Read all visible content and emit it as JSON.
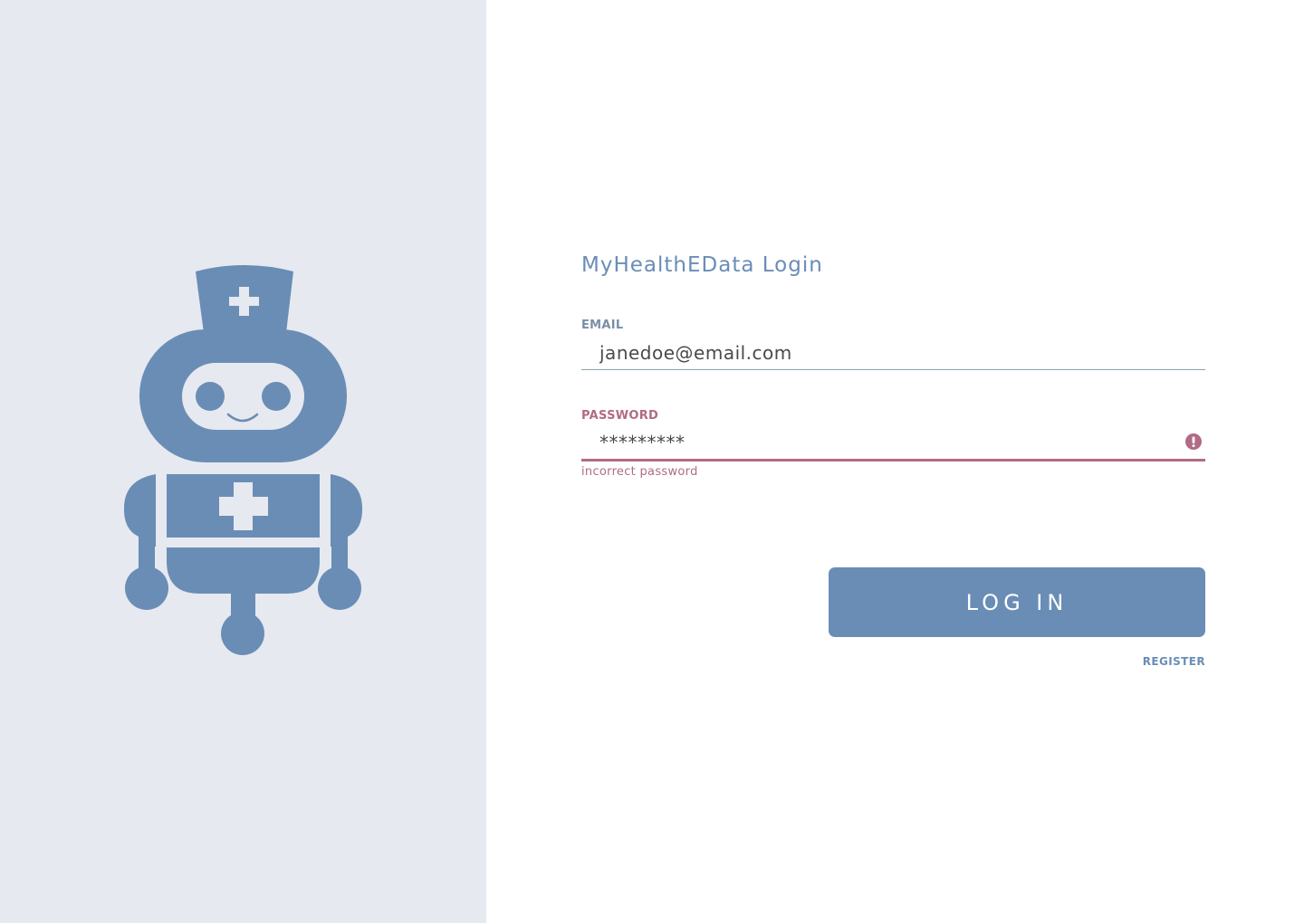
{
  "brand": {
    "title": "MyHealthEData Login",
    "mascot": "nurse-robot-icon",
    "accent_color": "#6a8db6",
    "panel_color": "#e6e9ef"
  },
  "email": {
    "label": "EMAIL",
    "value": "janedoe@email.com"
  },
  "password": {
    "label": "PASSWORD",
    "value": "*********",
    "error_text": "incorrect password",
    "error_icon": "exclamation-circle-icon",
    "error_color": "#b06b86"
  },
  "actions": {
    "login_label": "LOG IN",
    "register_label": "REGISTER"
  }
}
